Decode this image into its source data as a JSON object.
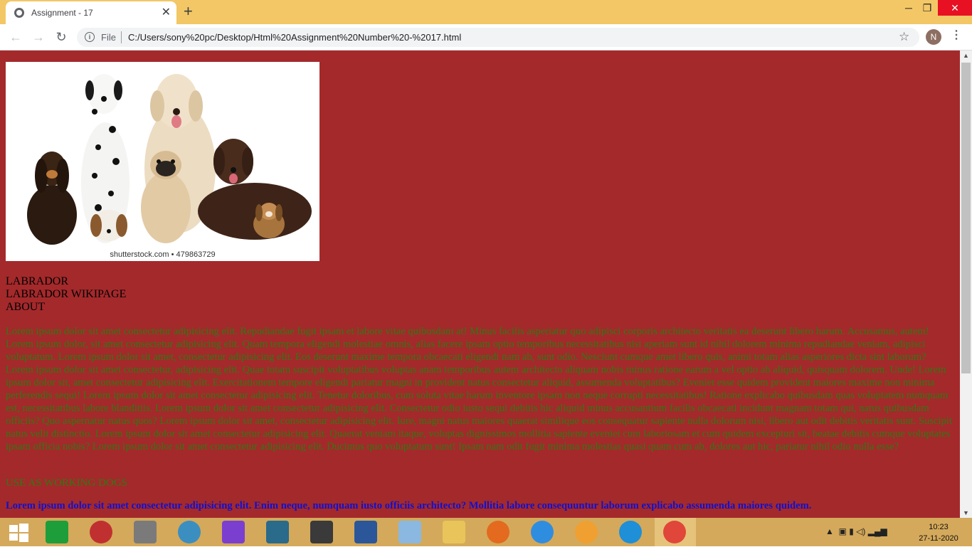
{
  "browser": {
    "tab_title": "Assignment - 17",
    "tab_close": "✕",
    "new_tab": "+",
    "window_controls": {
      "minimize": "─",
      "maximize": "❐",
      "close": "✕"
    },
    "nav": {
      "back": "←",
      "forward": "→",
      "reload": "↻"
    },
    "omnibox": {
      "scheme_label": "File",
      "url": "C:/Users/sony%20pc/Desktop/Html%20Assignment%20Number%20-%2017.html"
    },
    "bookmark_icon": "star-icon",
    "profile_initial": "N",
    "menu": "⋮"
  },
  "page": {
    "hero_image": {
      "caption": "shutterstock.com • 479863729"
    },
    "nav_links": [
      "LABRADOR",
      "LABRADOR WIKIPAGE",
      "ABOUT"
    ],
    "paragraph_1": "Lorem ipsum dolor sit amet consectetur adipisicing elit. Repudiandae fugit ipsam et labore vitae quibusdam at! Minus facilis asperiatur quo adipisci corporis architecto veritatis ea deserunt libero harum. Accusamus, autem! Lorem ipsum dolor, sit amet consectetur adipisicing elit. Quam tempora eligendi molestiae omnis, alias facere ipsam optio temporibus necessitatibus nisi aperiam sunt id nihil dolorem minima repudiandae veniam, adipisci voluptatum. Lorem ipsum dolor sit amet, consectetur adipisicing elit. Eos deserunt maxime tempora obcaecati eligendi nam ab, sunt odio. Nesciunt cumque amet libero quis, animi totam alias asperiores dicta sint laborum? Lorem ipsum dolor sit amet consectetur, adipisicing elit. Quae totam suscipit voluptatibus voluptas anam temporibus autem architecto aliquam nobis minus ratione earum a vel optio ab aliquid, quisquam dolorem. Unde! Lorem ipsum dolor sit, amet consectetur adipisicing elit. Exercitationem tempore eligendi pariatur magni in provident natus consectetur aliquid, assumenda voluptatibus? Eveniet esse quidem provident maiores maxime non minima perferendis sequi! Lorem ipsum dolor sit amet consectetur adipisicing elit. Tenetur doloribus, cum soluta vitae harum inventore ipsam non neque corrupti necessitatibus! Ratione explicabo quibusdam quas voluptatem numquam est, necessitatibus labore blanditiis. Lorem ipsum dolor sit amet consectetur adipisicing elit. Consectetur odio iusto sequi debitis hic aliquid minus accusantium facilis obcaecati incidunt magnam totam qui, natus quibusdam officiis? Quo aspernatur natus quos? Lorem ipsum dolor sit amet, consectetur adipisicing elit. Iure, magni natus maiores quaerat similique eos consequatur sapiente nulla dolorum nisi, libero aut odit debitis veritatis sunt. Suscipit natus velit distinctio. Lorem ipsum dolor sit amet consectetur adipisicing elit. Quaerat veniam itaque, voluptas dignissimos mollitia sapiente eveniet cum laboriosam et cum quidem excepturi sit, beatae debitis cumque voluptates ipsam officia nobis? Lorem ipsum dolor sit amet consectetur adipisicing elit. Ducimus quo voluptatum sunt! Ipsam nam odit fugit minima molestias quasi quam cum ab, dolores aut hic, pariatur nihil odio nulla esse?",
    "heading_working": "USE AS WORKING DOGS",
    "paragraph_2": "Lorem ipsum dolor sit amet consectetur adipisicing elit. Enim neque, numquam iusto officiis architecto? Mollitia labore consequuntur laborum explicabo assumenda maiores quidem."
  },
  "taskbar": {
    "apps": [
      "windows-start-icon",
      "store-icon",
      "media-player-icon",
      "scanner-icon",
      "dvd-icon",
      "visual-studio-icon",
      "video-editor-icon",
      "sublime-text-icon",
      "word-icon",
      "paint-icon",
      "file-explorer-icon",
      "firefox-icon",
      "internet-explorer-icon",
      "scratch-cat-icon",
      "edge-icon",
      "chrome-icon"
    ],
    "time": "10:23",
    "date": "27-11-2020",
    "tray_arrow": "▲"
  }
}
